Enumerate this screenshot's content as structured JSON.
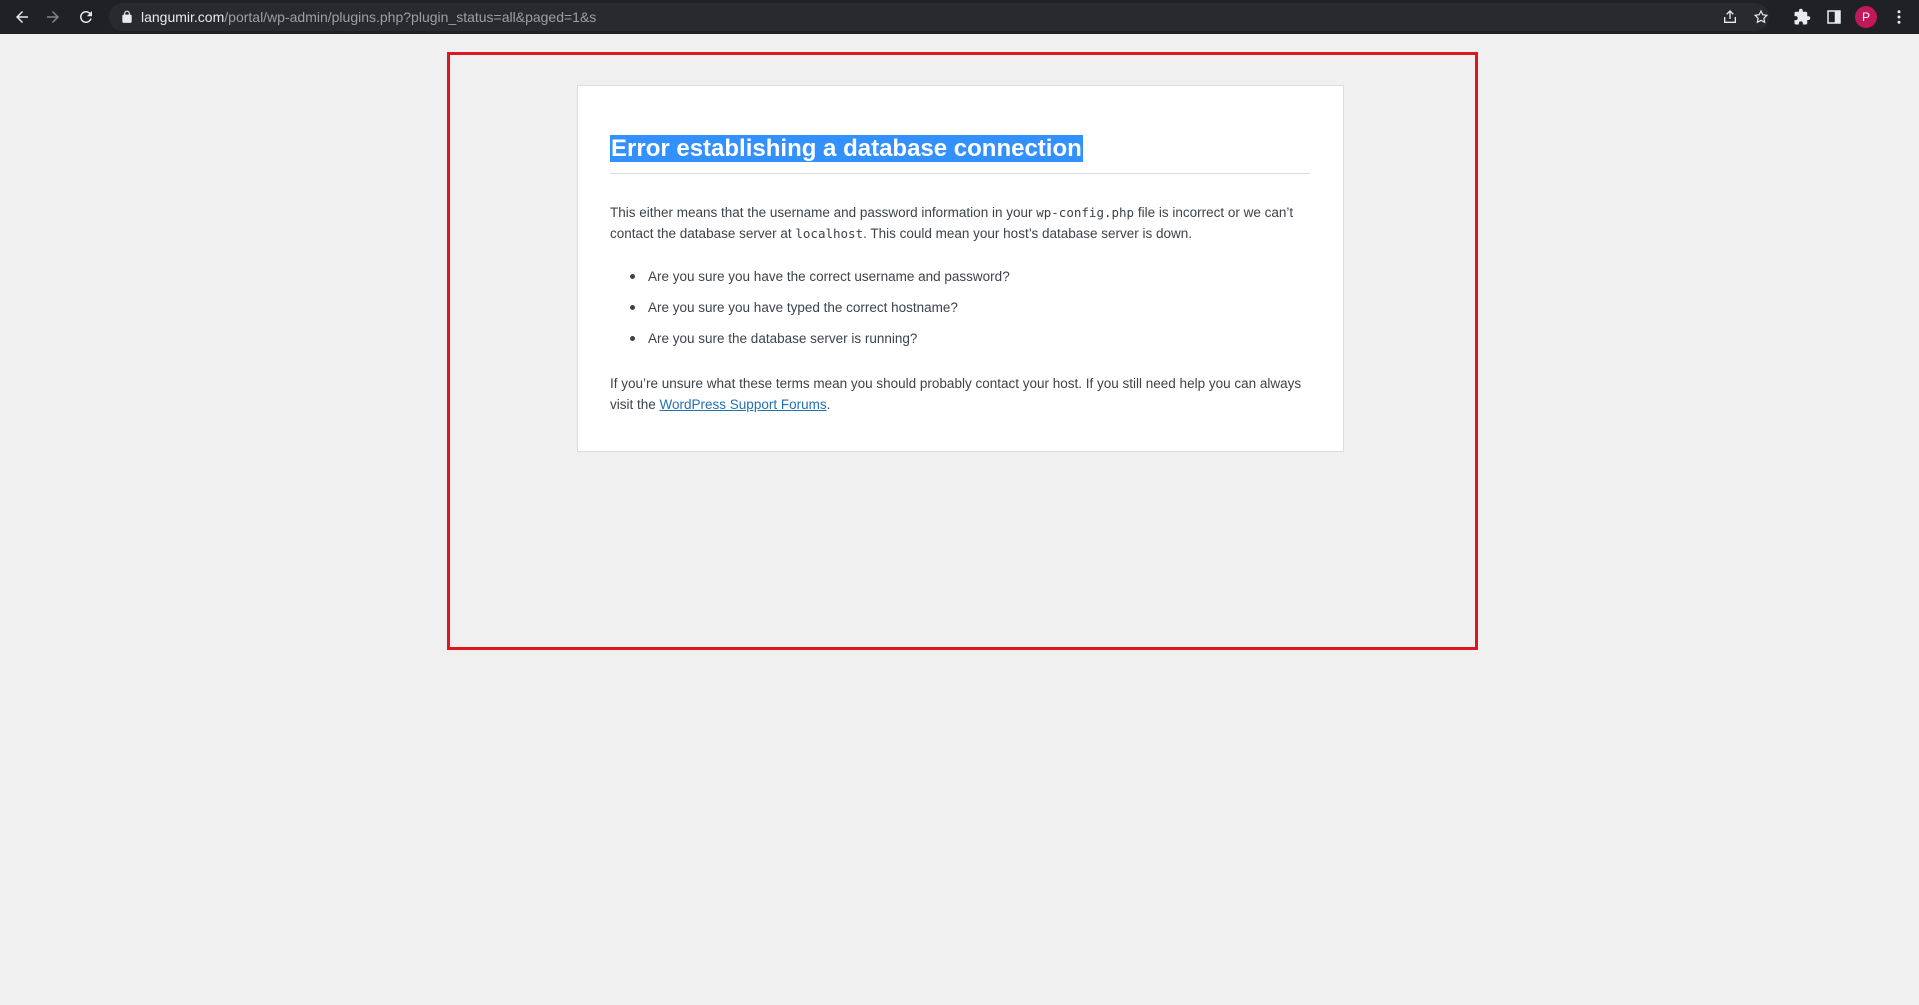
{
  "browser": {
    "url_host": "langumir.com",
    "url_path": "/portal/wp-admin/plugins.php?plugin_status=all&paged=1&s",
    "profile_initial": "P",
    "icons": {
      "back": "back-arrow-icon",
      "forward": "forward-arrow-icon",
      "reload": "reload-icon",
      "lock": "lock-icon",
      "share": "share-icon",
      "bookmark": "star-icon",
      "extensions": "puzzle-icon",
      "side_panel": "side-panel-icon",
      "menu": "kebab-menu-icon"
    },
    "colors": {
      "toolbar": "#202124",
      "omnibox": "#282a2d",
      "avatar": "#c2185b"
    }
  },
  "error": {
    "title": "Error establishing a database connection",
    "para1_a": "This either means that the username and password information in your ",
    "para1_code1": "wp-config.php",
    "para1_b": " file is incorrect or we can’t contact the database server at ",
    "para1_code2": "localhost",
    "para1_c": ". This could mean your host’s database server is down.",
    "items": [
      "Are you sure you have the correct username and password?",
      "Are you sure you have typed the correct hostname?",
      "Are you sure the database server is running?"
    ],
    "para2_a": "If you’re unsure what these terms mean you should probably contact your host. If you still need help you can always visit the ",
    "para2_link": "WordPress Support Forums",
    "para2_b": "."
  },
  "colors": {
    "page_bg": "#f0f0f1",
    "highlight_border": "#e0161e",
    "selection": "#3390ff",
    "link": "#2271b1"
  }
}
